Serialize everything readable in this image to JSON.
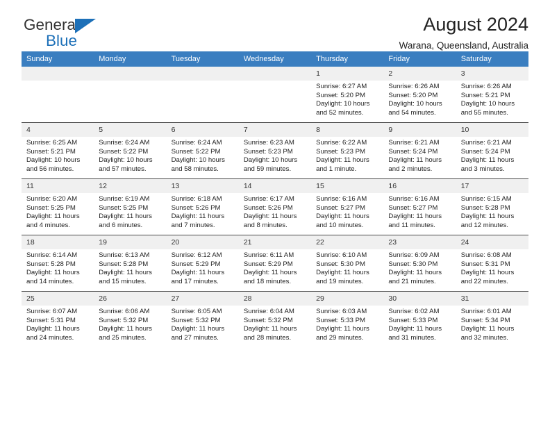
{
  "logo": {
    "word1": "General",
    "word2": "Blue",
    "triangle_icon": "blue-triangle-icon",
    "accent_color": "#1d70b8"
  },
  "header": {
    "title": "August 2024",
    "subtitle": "Warana, Queensland, Australia"
  },
  "theme": {
    "header_bg": "#3a7ec0",
    "header_text": "#ffffff",
    "date_band_bg": "#f0f0f0",
    "row_border": "#4a4a4a",
    "body_text": "#222222"
  },
  "weekday_headers": [
    "Sunday",
    "Monday",
    "Tuesday",
    "Wednesday",
    "Thursday",
    "Friday",
    "Saturday"
  ],
  "weeks": [
    [
      {
        "date": "",
        "blank": true
      },
      {
        "date": "",
        "blank": true
      },
      {
        "date": "",
        "blank": true
      },
      {
        "date": "",
        "blank": true
      },
      {
        "date": "1",
        "sunrise": "Sunrise: 6:27 AM",
        "sunset": "Sunset: 5:20 PM",
        "daylight1": "Daylight: 10 hours",
        "daylight2": "and 52 minutes."
      },
      {
        "date": "2",
        "sunrise": "Sunrise: 6:26 AM",
        "sunset": "Sunset: 5:20 PM",
        "daylight1": "Daylight: 10 hours",
        "daylight2": "and 54 minutes."
      },
      {
        "date": "3",
        "sunrise": "Sunrise: 6:26 AM",
        "sunset": "Sunset: 5:21 PM",
        "daylight1": "Daylight: 10 hours",
        "daylight2": "and 55 minutes."
      }
    ],
    [
      {
        "date": "4",
        "sunrise": "Sunrise: 6:25 AM",
        "sunset": "Sunset: 5:21 PM",
        "daylight1": "Daylight: 10 hours",
        "daylight2": "and 56 minutes."
      },
      {
        "date": "5",
        "sunrise": "Sunrise: 6:24 AM",
        "sunset": "Sunset: 5:22 PM",
        "daylight1": "Daylight: 10 hours",
        "daylight2": "and 57 minutes."
      },
      {
        "date": "6",
        "sunrise": "Sunrise: 6:24 AM",
        "sunset": "Sunset: 5:22 PM",
        "daylight1": "Daylight: 10 hours",
        "daylight2": "and 58 minutes."
      },
      {
        "date": "7",
        "sunrise": "Sunrise: 6:23 AM",
        "sunset": "Sunset: 5:23 PM",
        "daylight1": "Daylight: 10 hours",
        "daylight2": "and 59 minutes."
      },
      {
        "date": "8",
        "sunrise": "Sunrise: 6:22 AM",
        "sunset": "Sunset: 5:23 PM",
        "daylight1": "Daylight: 11 hours",
        "daylight2": "and 1 minute."
      },
      {
        "date": "9",
        "sunrise": "Sunrise: 6:21 AM",
        "sunset": "Sunset: 5:24 PM",
        "daylight1": "Daylight: 11 hours",
        "daylight2": "and 2 minutes."
      },
      {
        "date": "10",
        "sunrise": "Sunrise: 6:21 AM",
        "sunset": "Sunset: 5:24 PM",
        "daylight1": "Daylight: 11 hours",
        "daylight2": "and 3 minutes."
      }
    ],
    [
      {
        "date": "11",
        "sunrise": "Sunrise: 6:20 AM",
        "sunset": "Sunset: 5:25 PM",
        "daylight1": "Daylight: 11 hours",
        "daylight2": "and 4 minutes."
      },
      {
        "date": "12",
        "sunrise": "Sunrise: 6:19 AM",
        "sunset": "Sunset: 5:25 PM",
        "daylight1": "Daylight: 11 hours",
        "daylight2": "and 6 minutes."
      },
      {
        "date": "13",
        "sunrise": "Sunrise: 6:18 AM",
        "sunset": "Sunset: 5:26 PM",
        "daylight1": "Daylight: 11 hours",
        "daylight2": "and 7 minutes."
      },
      {
        "date": "14",
        "sunrise": "Sunrise: 6:17 AM",
        "sunset": "Sunset: 5:26 PM",
        "daylight1": "Daylight: 11 hours",
        "daylight2": "and 8 minutes."
      },
      {
        "date": "15",
        "sunrise": "Sunrise: 6:16 AM",
        "sunset": "Sunset: 5:27 PM",
        "daylight1": "Daylight: 11 hours",
        "daylight2": "and 10 minutes."
      },
      {
        "date": "16",
        "sunrise": "Sunrise: 6:16 AM",
        "sunset": "Sunset: 5:27 PM",
        "daylight1": "Daylight: 11 hours",
        "daylight2": "and 11 minutes."
      },
      {
        "date": "17",
        "sunrise": "Sunrise: 6:15 AM",
        "sunset": "Sunset: 5:28 PM",
        "daylight1": "Daylight: 11 hours",
        "daylight2": "and 12 minutes."
      }
    ],
    [
      {
        "date": "18",
        "sunrise": "Sunrise: 6:14 AM",
        "sunset": "Sunset: 5:28 PM",
        "daylight1": "Daylight: 11 hours",
        "daylight2": "and 14 minutes."
      },
      {
        "date": "19",
        "sunrise": "Sunrise: 6:13 AM",
        "sunset": "Sunset: 5:28 PM",
        "daylight1": "Daylight: 11 hours",
        "daylight2": "and 15 minutes."
      },
      {
        "date": "20",
        "sunrise": "Sunrise: 6:12 AM",
        "sunset": "Sunset: 5:29 PM",
        "daylight1": "Daylight: 11 hours",
        "daylight2": "and 17 minutes."
      },
      {
        "date": "21",
        "sunrise": "Sunrise: 6:11 AM",
        "sunset": "Sunset: 5:29 PM",
        "daylight1": "Daylight: 11 hours",
        "daylight2": "and 18 minutes."
      },
      {
        "date": "22",
        "sunrise": "Sunrise: 6:10 AM",
        "sunset": "Sunset: 5:30 PM",
        "daylight1": "Daylight: 11 hours",
        "daylight2": "and 19 minutes."
      },
      {
        "date": "23",
        "sunrise": "Sunrise: 6:09 AM",
        "sunset": "Sunset: 5:30 PM",
        "daylight1": "Daylight: 11 hours",
        "daylight2": "and 21 minutes."
      },
      {
        "date": "24",
        "sunrise": "Sunrise: 6:08 AM",
        "sunset": "Sunset: 5:31 PM",
        "daylight1": "Daylight: 11 hours",
        "daylight2": "and 22 minutes."
      }
    ],
    [
      {
        "date": "25",
        "sunrise": "Sunrise: 6:07 AM",
        "sunset": "Sunset: 5:31 PM",
        "daylight1": "Daylight: 11 hours",
        "daylight2": "and 24 minutes."
      },
      {
        "date": "26",
        "sunrise": "Sunrise: 6:06 AM",
        "sunset": "Sunset: 5:32 PM",
        "daylight1": "Daylight: 11 hours",
        "daylight2": "and 25 minutes."
      },
      {
        "date": "27",
        "sunrise": "Sunrise: 6:05 AM",
        "sunset": "Sunset: 5:32 PM",
        "daylight1": "Daylight: 11 hours",
        "daylight2": "and 27 minutes."
      },
      {
        "date": "28",
        "sunrise": "Sunrise: 6:04 AM",
        "sunset": "Sunset: 5:32 PM",
        "daylight1": "Daylight: 11 hours",
        "daylight2": "and 28 minutes."
      },
      {
        "date": "29",
        "sunrise": "Sunrise: 6:03 AM",
        "sunset": "Sunset: 5:33 PM",
        "daylight1": "Daylight: 11 hours",
        "daylight2": "and 29 minutes."
      },
      {
        "date": "30",
        "sunrise": "Sunrise: 6:02 AM",
        "sunset": "Sunset: 5:33 PM",
        "daylight1": "Daylight: 11 hours",
        "daylight2": "and 31 minutes."
      },
      {
        "date": "31",
        "sunrise": "Sunrise: 6:01 AM",
        "sunset": "Sunset: 5:34 PM",
        "daylight1": "Daylight: 11 hours",
        "daylight2": "and 32 minutes."
      }
    ]
  ]
}
